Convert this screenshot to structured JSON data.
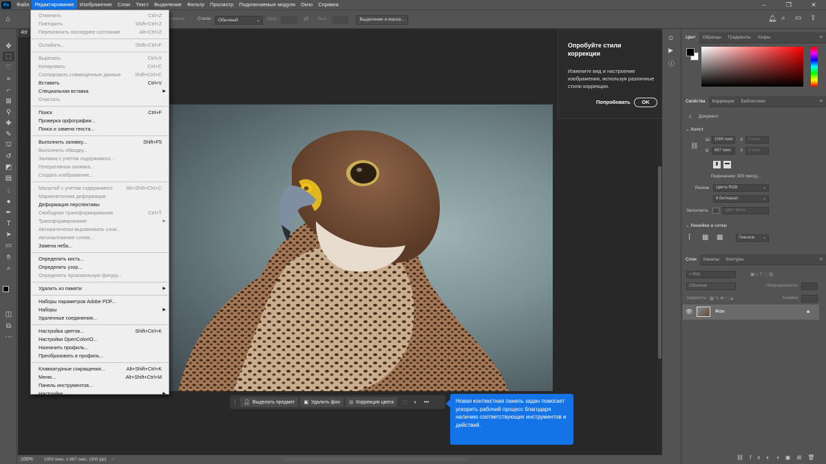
{
  "app": {
    "logo": "Ps"
  },
  "menubar": [
    "Файл",
    "Редактирование",
    "Изображение",
    "Слои",
    "Текст",
    "Выделение",
    "Фильтр",
    "Просмотр",
    "Подключаемые модули",
    "Окно",
    "Справка"
  ],
  "options_bar": {
    "label_style": "Стили:",
    "style_value": "Обычный",
    "width_label": "Шир.:",
    "height_label": "Выс.:",
    "select_mask_button": "Выделение и маска...",
    "hidden_label": "ование"
  },
  "doc_tab": "4bf",
  "edit_menu": [
    {
      "label": "Отменить",
      "shortcut": "Ctrl+Z",
      "disabled": true
    },
    {
      "label": "Повторить",
      "shortcut": "Shift+Ctrl+Z",
      "disabled": true
    },
    {
      "label": "Переключить последнее состояние",
      "shortcut": "Alt+Ctrl+Z",
      "disabled": true
    },
    {
      "sep": true
    },
    {
      "label": "Ослабить...",
      "shortcut": "Shift+Ctrl+F",
      "disabled": true
    },
    {
      "sep": true
    },
    {
      "label": "Вырезать",
      "shortcut": "Ctrl+X",
      "disabled": true
    },
    {
      "label": "Копировать",
      "shortcut": "Ctrl+C",
      "disabled": true
    },
    {
      "label": "Скопировать совмещенные данные",
      "shortcut": "Shift+Ctrl+C",
      "disabled": true
    },
    {
      "label": "Вставить",
      "shortcut": "Ctrl+V",
      "disabled": false
    },
    {
      "label": "Специальная вставка",
      "submenu": true,
      "disabled": false
    },
    {
      "label": "Очистить",
      "disabled": true
    },
    {
      "sep": true
    },
    {
      "label": "Поиск",
      "shortcut": "Ctrl+F",
      "disabled": false
    },
    {
      "label": "Проверка орфографии...",
      "disabled": false
    },
    {
      "label": "Поиск и замена текста...",
      "disabled": false
    },
    {
      "sep": true
    },
    {
      "label": "Выполнить заливку...",
      "shortcut": "Shift+F5",
      "disabled": false
    },
    {
      "label": "Выполнить обводку...",
      "disabled": true
    },
    {
      "label": "Заливка с учетом содержимого...",
      "disabled": true
    },
    {
      "label": "Генеративная заливка...",
      "disabled": true
    },
    {
      "label": "Создать изображение...",
      "disabled": true
    },
    {
      "sep": true
    },
    {
      "label": "Масштаб с учетом содержимого",
      "shortcut": "Alt+Shift+Ctrl+C",
      "disabled": true
    },
    {
      "label": "Марионеточная деформация",
      "disabled": true
    },
    {
      "label": "Деформация перспективы",
      "disabled": false
    },
    {
      "label": "Свободное трансформирование",
      "shortcut": "Ctrl+T",
      "disabled": true
    },
    {
      "label": "Трансформирование",
      "submenu": true,
      "disabled": true
    },
    {
      "label": "Автоматически выравнивать слои...",
      "disabled": true
    },
    {
      "label": "Автоналожение слоев...",
      "disabled": true
    },
    {
      "label": "Замена неба...",
      "disabled": false
    },
    {
      "sep": true
    },
    {
      "label": "Определить кисть...",
      "disabled": false
    },
    {
      "label": "Определить узор...",
      "disabled": false
    },
    {
      "label": "Определить произвольную фигуру...",
      "disabled": true
    },
    {
      "sep": true
    },
    {
      "label": "Удалить из памяти",
      "submenu": true,
      "disabled": false
    },
    {
      "sep": true
    },
    {
      "label": "Наборы параметров Adobe PDF...",
      "disabled": false
    },
    {
      "label": "Наборы",
      "submenu": true,
      "disabled": false
    },
    {
      "label": "Удаленные соединения...",
      "disabled": false
    },
    {
      "sep": true
    },
    {
      "label": "Настройка цветов...",
      "shortcut": "Shift+Ctrl+K",
      "disabled": false
    },
    {
      "label": "Настройки OpenColorIO...",
      "disabled": false
    },
    {
      "label": "Назначить профиль...",
      "disabled": false
    },
    {
      "label": "Преобразовать в профиль...",
      "disabled": false
    },
    {
      "sep": true
    },
    {
      "label": "Клавиатурные сокращения...",
      "shortcut": "Alt+Shift+Ctrl+K",
      "disabled": false
    },
    {
      "label": "Меню...",
      "shortcut": "Alt+Shift+Ctrl+M",
      "disabled": false
    },
    {
      "label": "Панель инструментов...",
      "disabled": false
    },
    {
      "label": "Настройки",
      "submenu": true,
      "disabled": false
    }
  ],
  "tip_popup": {
    "title": "Опробуйте стили коррекции",
    "body": "Измените вид и настроение изображения, используя различные стили коррекции.",
    "try_button": "Попробовать",
    "ok_button": "OK"
  },
  "contextual_bar": {
    "select_subject": "Выделить предмет",
    "remove_bg": "Удалить фон",
    "color_correction": "Коррекция цвета"
  },
  "blue_tip": "Новая контекстная панель задач помогает ускорить рабочий процесс благодаря наличию соответствующих инструментов и действий.",
  "status": {
    "zoom": "100%",
    "doc_info": "1000 пикс. x 667 пикс. (300 ppi)"
  },
  "color_panel": {
    "tabs": [
      "Цвет",
      "Образцы",
      "Градиенты",
      "Узоры"
    ],
    "fg": "#000000",
    "bg": "#ffffff",
    "hue": "#ff0000"
  },
  "properties_panel": {
    "tabs": [
      "Свойства",
      "Коррекция",
      "Библиотеки"
    ],
    "document_label": "Документ",
    "canvas_section": "Холст",
    "w_label": "Ш",
    "w_value": "1000 пикс",
    "h_label": "В",
    "h_value": "667 пикс",
    "x_label": "X",
    "x_value": "0 пикс",
    "y_label": "Y",
    "y_value": "0 пикс",
    "resolution": "Разрешение: 300 пикс/д...",
    "mode_label": "Режим",
    "mode_value": "Цвета RGB",
    "depth_value": "8 бит/канал",
    "fill_label": "Заполнить",
    "fill_value": "Цвет фона",
    "rulers_section": "Линейки и сетки",
    "units_value": "Пиксели"
  },
  "layers_panel": {
    "tabs": [
      "Слои",
      "Каналы",
      "Контуры"
    ],
    "search_placeholder": "Вид",
    "blend_mode": "Обычные",
    "opacity_label": "Непрозрачность:",
    "lock_label": "Закрепить:",
    "fill_label": "Заливка:",
    "layer_name": "Фон"
  }
}
